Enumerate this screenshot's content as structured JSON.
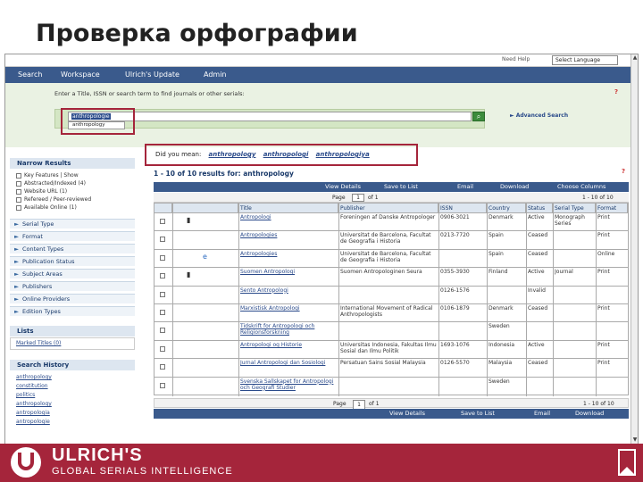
{
  "slide": {
    "title": "Проверка орфографии"
  },
  "app": {
    "top_links": [
      "Need Help",
      "Select Language"
    ],
    "nav": [
      "Search",
      "Workspace",
      "Ulrich's Update",
      "Admin"
    ]
  },
  "search": {
    "hint": "Enter a Title, ISSN or search term to find journals or other serials:",
    "query": "anthropologie",
    "suggestion": "anthropology",
    "advanced_label": "Advanced Search",
    "button_icon": "search-icon"
  },
  "did_you_mean": {
    "label": "Did you mean:",
    "options": [
      "anthropology",
      "anthropologi",
      "anthropologiya"
    ]
  },
  "results": {
    "header": "1 - 10 of 10 results for: anthropology",
    "toolbar": [
      "View Details",
      "Save to List",
      "Email",
      "Download",
      "Choose Columns"
    ],
    "pager_label": "Page",
    "pager_value": "1",
    "pager_of": "of 1",
    "range": "1 - 10 of 10",
    "columns": [
      "",
      "",
      "Title",
      "Publisher",
      "ISSN",
      "Country",
      "Status",
      "Serial Type",
      "Format"
    ],
    "rows": [
      {
        "icons": "book",
        "title": "Antropologi",
        "publisher": "Foreningen af Danske Antropologer",
        "issn": "0906-3021",
        "country": "Denmark",
        "status": "Active",
        "serial_type": "Monograph Series",
        "format": "Print"
      },
      {
        "icons": "",
        "title": "Antropologies",
        "publisher": "Universitat de Barcelona, Facultat de Geografia i Historia",
        "issn": "0213-7720",
        "country": "Spain",
        "status": "Ceased",
        "serial_type": "",
        "format": "Print"
      },
      {
        "icons": "e",
        "title": "Antropologies",
        "publisher": "Universitat de Barcelona, Facultat de Geografia i Historia",
        "issn": "",
        "country": "Spain",
        "status": "Ceased",
        "serial_type": "",
        "format": "Online"
      },
      {
        "icons": "book",
        "title": "Suomen Antropologi",
        "publisher": "Suomen Antropologinen Seura",
        "issn": "0355-3930",
        "country": "Finland",
        "status": "Active",
        "serial_type": "Journal",
        "format": "Print"
      },
      {
        "icons": "",
        "title": "Sento Antropologi",
        "publisher": "",
        "issn": "0126-1576",
        "country": "",
        "status": "Invalid",
        "serial_type": "",
        "format": ""
      },
      {
        "icons": "",
        "title": "Marxistisk Antropologi",
        "publisher": "International Movement of Radical Anthropologists",
        "issn": "0106-1879",
        "country": "Denmark",
        "status": "Ceased",
        "serial_type": "",
        "format": "Print"
      },
      {
        "icons": "",
        "title": "Tidskrift for Antropologi och Religionsforskning",
        "publisher": "",
        "issn": "",
        "country": "Sweden",
        "status": "",
        "serial_type": "",
        "format": ""
      },
      {
        "icons": "",
        "title": "Antropologi og Historie",
        "publisher": "Universitas Indonesia, Fakultas Ilmu Sosial dan Ilmu Politik",
        "issn": "1693-1076",
        "country": "Indonesia",
        "status": "Active",
        "serial_type": "",
        "format": "Print"
      },
      {
        "icons": "",
        "title": "Jurnal Antropologi dan Sosiologi",
        "publisher": "Persatuan Sains Sosial Malaysia",
        "issn": "0126-5570",
        "country": "Malaysia",
        "status": "Ceased",
        "serial_type": "",
        "format": "Print"
      },
      {
        "icons": "",
        "title": "Svenska Sallskapet for Antropologi och Geografi Studier",
        "publisher": "",
        "issn": "",
        "country": "Sweden",
        "status": "",
        "serial_type": "",
        "format": ""
      }
    ],
    "bottom_tools": [
      "View Details",
      "Save to List",
      "Email",
      "Download"
    ]
  },
  "sidebar": {
    "narrow_title": "Narrow Results",
    "features": [
      "Key Features | Show",
      "Abstracted/Indexed (4)",
      "Website URL (1)",
      "Refereed / Peer-reviewed",
      "Available Online (1)"
    ],
    "facets": [
      "Serial Type",
      "Format",
      "Content Types",
      "Publication Status",
      "Subject Areas",
      "Publishers",
      "Online Providers",
      "Edition Types"
    ],
    "lists_title": "Lists",
    "list_item": "Marked Titles (0)",
    "history_title": "Search History",
    "history": [
      "anthropology",
      "constitution",
      "politics",
      "anthropology",
      "antropologia",
      "antropologie"
    ]
  },
  "footer": {
    "brand": "ULRICH'S",
    "tagline": "GLOBAL SERIALS INTELLIGENCE",
    "accent": "#a5253b"
  }
}
